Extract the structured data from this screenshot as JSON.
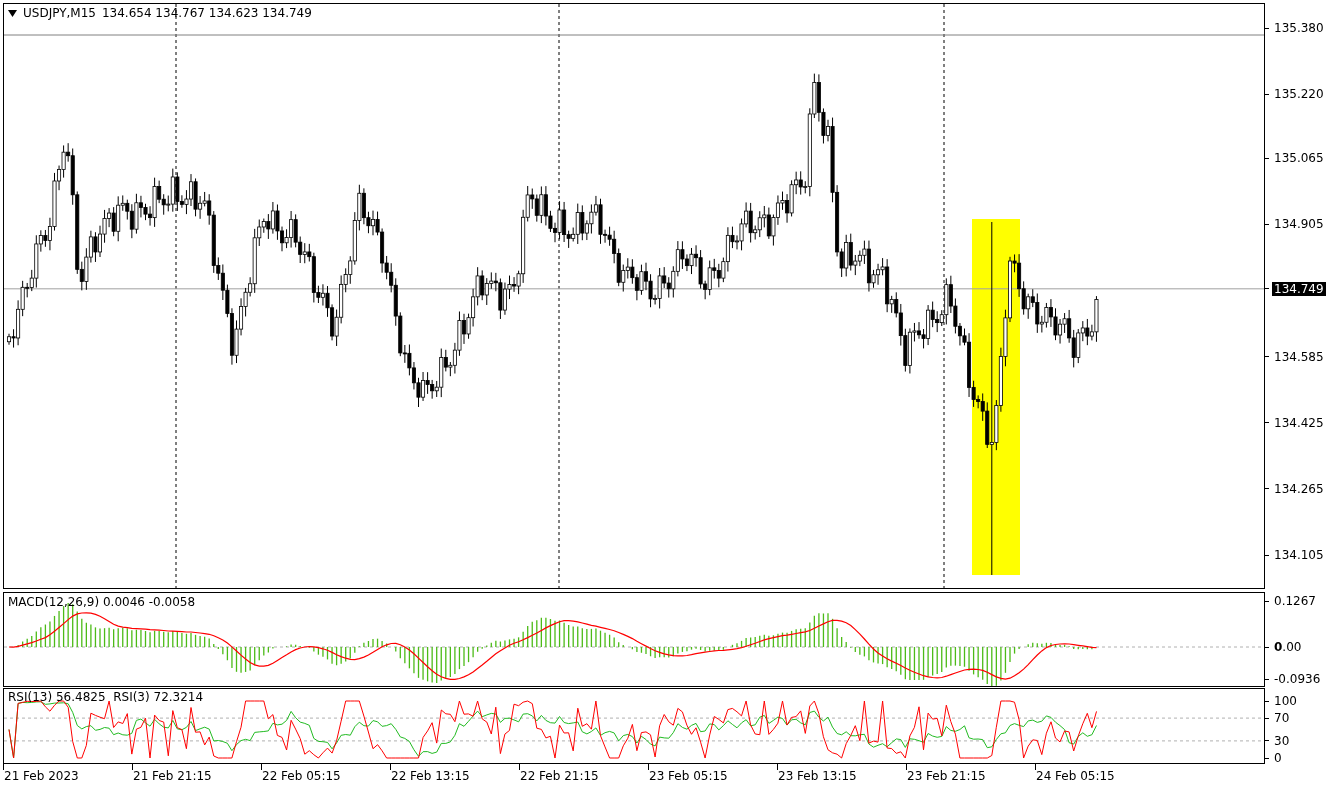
{
  "header": {
    "symbol": "USDJPY,M15",
    "quote": "134.654 134.767 134.623 134.749"
  },
  "price_axis": {
    "ticks": [
      "135.380",
      "135.220",
      "135.065",
      "134.905",
      "134.585",
      "134.425",
      "134.265",
      "134.105"
    ],
    "current_price": "134.749"
  },
  "macd": {
    "label": "MACD(12,26,9) 0.0046 -0.0058",
    "ticks": [
      "0.1267",
      "**0**.00",
      "-0.0936"
    ]
  },
  "rsi": {
    "label": "RSI(13) 56.4825  RSI(3) 72.3214",
    "ticks": [
      "100",
      "70",
      "30",
      "0"
    ]
  },
  "time_axis": {
    "labels": [
      "21 Feb 2023",
      "21 Feb 21:15",
      "22 Feb 05:15",
      "22 Feb 13:15",
      "22 Feb 21:15",
      "23 Feb 05:15",
      "23 Feb 13:15",
      "23 Feb 21:15",
      "24 Feb 05:15"
    ]
  }
}
